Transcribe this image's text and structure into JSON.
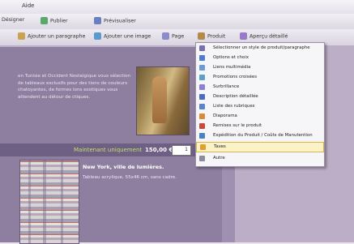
{
  "menubar": {
    "aide": "Aide"
  },
  "toolbar1": {
    "designer": "Désigner",
    "publier": "Publier",
    "previsualiser": "Prévisualiser"
  },
  "toolbar2": {
    "ajouter_paragraphe": "Ajouter un paragraphe",
    "ajouter_image": "Ajouter une image",
    "page": "Page",
    "produit": "Produit",
    "apercu": "Aperçu détaillé"
  },
  "content": {
    "intro": "en Tunisie et Occident Nostalgique vous sélection de tableaux exclusifs pour des tions de couleurs chatoyantes, de formes ions exotiques vous attendent au détour de ctiques.",
    "price_label": "Maintenant uniquement",
    "price_value": "150,00 €",
    "qty": "1",
    "product_title": "New York, ville de lumières.",
    "product_desc": "Tableau acrylique, 55x46 cm, sans cadre."
  },
  "menu": {
    "items": [
      {
        "label": "Sélectionner un style de produit/paragraphe",
        "icon": "style-icon",
        "color": "#7a6fb0"
      },
      {
        "label": "Options et choix",
        "icon": "options-icon",
        "color": "#4f7bd0"
      },
      {
        "label": "Liens multimédia",
        "icon": "media-icon",
        "color": "#6f9ad8"
      },
      {
        "label": "Promotions croisées",
        "icon": "promo-icon",
        "color": "#5aa0c8"
      },
      {
        "label": "Surbrillance",
        "icon": "highlight-icon",
        "color": "#8c7ed0"
      },
      {
        "label": "Description détaillée",
        "icon": "description-icon",
        "color": "#4a6cc0"
      },
      {
        "label": "Liste des rubriques",
        "icon": "list-icon",
        "color": "#5b84c8"
      },
      {
        "label": "Diaporama",
        "icon": "slideshow-icon",
        "color": "#d98a3a"
      },
      {
        "label": "Remises sur le produit",
        "icon": "discount-icon",
        "color": "#c94a3a"
      },
      {
        "label": "Expédition du Produit / Coûts de Manutention",
        "icon": "shipping-icon",
        "color": "#4c7fc4"
      },
      {
        "label": "Taxes",
        "icon": "tax-icon",
        "color": "#e0a030"
      },
      {
        "label": "Autre",
        "icon": "other-icon",
        "color": "#8a8a9a"
      }
    ]
  }
}
